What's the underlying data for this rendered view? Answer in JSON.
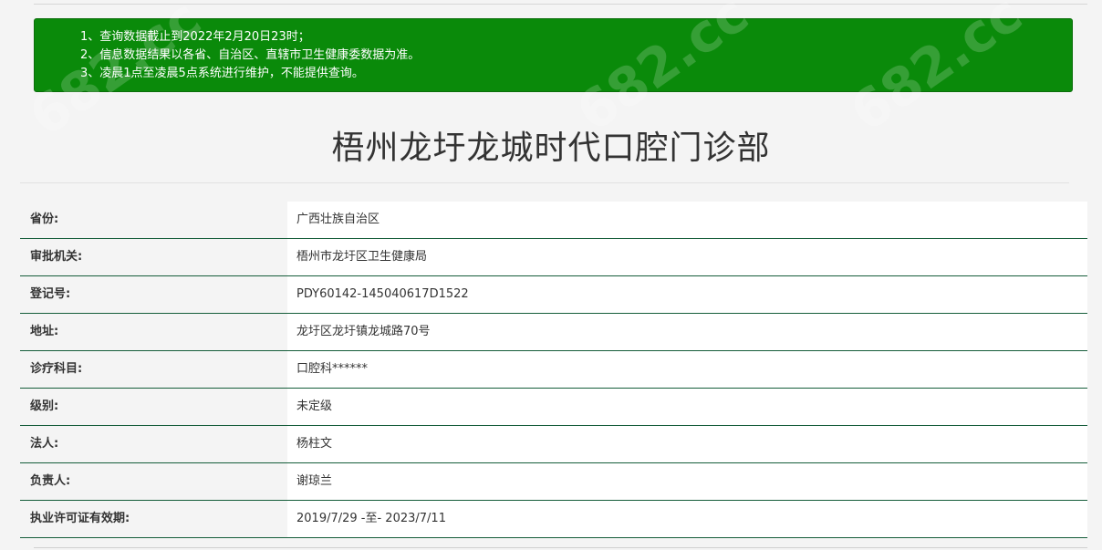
{
  "notice": {
    "lines": [
      "1、查询数据截止到2022年2月20日23时；",
      "2、信息数据结果以各省、自治区、直辖市卫生健康委数据为准。",
      "3、凌晨1点至凌晨5点系统进行维护，不能提供查询。"
    ]
  },
  "page_title": "梧州龙圩龙城时代口腔门诊部",
  "watermark_text": "682.cc",
  "details": [
    {
      "label": "省份:",
      "value": "广西壮族自治区"
    },
    {
      "label": "审批机关:",
      "value": "梧州市龙圩区卫生健康局"
    },
    {
      "label": "登记号:",
      "value": "PDY60142-145040617D1522"
    },
    {
      "label": "地址:",
      "value": "龙圩区龙圩镇龙城路70号"
    },
    {
      "label": "诊疗科目:",
      "value": "口腔科******"
    },
    {
      "label": "级别:",
      "value": "未定级"
    },
    {
      "label": "法人:",
      "value": "杨柱文"
    },
    {
      "label": "负责人:",
      "value": "谢琼兰"
    },
    {
      "label": "执业许可证有效期:",
      "value": "2019/7/29 -至- 2023/7/11"
    }
  ],
  "colors": {
    "notice_bg": "#0a8a0a",
    "row_border": "#155d3a",
    "page_bg": "#f4f4f4"
  }
}
